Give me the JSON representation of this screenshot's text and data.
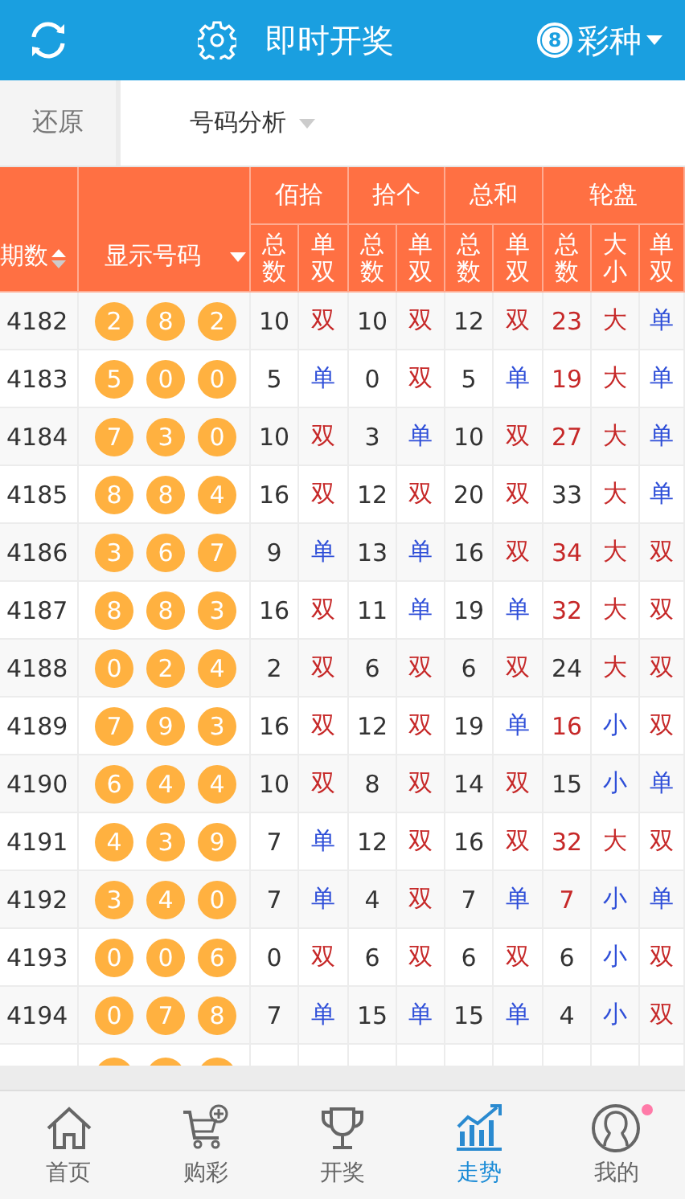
{
  "header": {
    "title": "即时开奖",
    "lottery_badge": "8",
    "lottery_label": "彩种"
  },
  "toolbar": {
    "reset": "还原",
    "filter": "号码分析"
  },
  "table": {
    "col_period": "期数",
    "col_numbers": "显示号码",
    "groups": [
      {
        "label": "佰拾",
        "sub": [
          "总数",
          "单双"
        ]
      },
      {
        "label": "拾个",
        "sub": [
          "总数",
          "单双"
        ]
      },
      {
        "label": "总和",
        "sub": [
          "总数",
          "单双"
        ]
      },
      {
        "label": "轮盘",
        "sub": [
          "总数",
          "大小",
          "单双"
        ]
      }
    ],
    "rows": [
      {
        "period": "4182",
        "balls": [
          "2",
          "8",
          "2"
        ],
        "cells": [
          {
            "text": "10",
            "color": "#333333"
          },
          {
            "text": "双",
            "color": "#c62828"
          },
          {
            "text": "10",
            "color": "#333333"
          },
          {
            "text": "双",
            "color": "#c62828"
          },
          {
            "text": "12",
            "color": "#333333"
          },
          {
            "text": "双",
            "color": "#c62828"
          },
          {
            "text": "23",
            "color": "#c62828"
          },
          {
            "text": "大",
            "color": "#c62828"
          },
          {
            "text": "单",
            "color": "#2f4fd8"
          }
        ]
      },
      {
        "period": "4183",
        "balls": [
          "5",
          "0",
          "0"
        ],
        "cells": [
          {
            "text": "5",
            "color": "#333333"
          },
          {
            "text": "单",
            "color": "#2f4fd8"
          },
          {
            "text": "0",
            "color": "#333333"
          },
          {
            "text": "双",
            "color": "#c62828"
          },
          {
            "text": "5",
            "color": "#333333"
          },
          {
            "text": "单",
            "color": "#2f4fd8"
          },
          {
            "text": "19",
            "color": "#c62828"
          },
          {
            "text": "大",
            "color": "#c62828"
          },
          {
            "text": "单",
            "color": "#2f4fd8"
          }
        ]
      },
      {
        "period": "4184",
        "balls": [
          "7",
          "3",
          "0"
        ],
        "cells": [
          {
            "text": "10",
            "color": "#333333"
          },
          {
            "text": "双",
            "color": "#c62828"
          },
          {
            "text": "3",
            "color": "#333333"
          },
          {
            "text": "单",
            "color": "#2f4fd8"
          },
          {
            "text": "10",
            "color": "#333333"
          },
          {
            "text": "双",
            "color": "#c62828"
          },
          {
            "text": "27",
            "color": "#c62828"
          },
          {
            "text": "大",
            "color": "#c62828"
          },
          {
            "text": "单",
            "color": "#2f4fd8"
          }
        ]
      },
      {
        "period": "4185",
        "balls": [
          "8",
          "8",
          "4"
        ],
        "cells": [
          {
            "text": "16",
            "color": "#333333"
          },
          {
            "text": "双",
            "color": "#c62828"
          },
          {
            "text": "12",
            "color": "#333333"
          },
          {
            "text": "双",
            "color": "#c62828"
          },
          {
            "text": "20",
            "color": "#333333"
          },
          {
            "text": "双",
            "color": "#c62828"
          },
          {
            "text": "33",
            "color": "#333333"
          },
          {
            "text": "大",
            "color": "#c62828"
          },
          {
            "text": "单",
            "color": "#2f4fd8"
          }
        ]
      },
      {
        "period": "4186",
        "balls": [
          "3",
          "6",
          "7"
        ],
        "cells": [
          {
            "text": "9",
            "color": "#333333"
          },
          {
            "text": "单",
            "color": "#2f4fd8"
          },
          {
            "text": "13",
            "color": "#333333"
          },
          {
            "text": "单",
            "color": "#2f4fd8"
          },
          {
            "text": "16",
            "color": "#333333"
          },
          {
            "text": "双",
            "color": "#c62828"
          },
          {
            "text": "34",
            "color": "#c62828"
          },
          {
            "text": "大",
            "color": "#c62828"
          },
          {
            "text": "双",
            "color": "#c62828"
          }
        ]
      },
      {
        "period": "4187",
        "balls": [
          "8",
          "8",
          "3"
        ],
        "cells": [
          {
            "text": "16",
            "color": "#333333"
          },
          {
            "text": "双",
            "color": "#c62828"
          },
          {
            "text": "11",
            "color": "#333333"
          },
          {
            "text": "单",
            "color": "#2f4fd8"
          },
          {
            "text": "19",
            "color": "#333333"
          },
          {
            "text": "单",
            "color": "#2f4fd8"
          },
          {
            "text": "32",
            "color": "#c62828"
          },
          {
            "text": "大",
            "color": "#c62828"
          },
          {
            "text": "双",
            "color": "#c62828"
          }
        ]
      },
      {
        "period": "4188",
        "balls": [
          "0",
          "2",
          "4"
        ],
        "cells": [
          {
            "text": "2",
            "color": "#333333"
          },
          {
            "text": "双",
            "color": "#c62828"
          },
          {
            "text": "6",
            "color": "#333333"
          },
          {
            "text": "双",
            "color": "#c62828"
          },
          {
            "text": "6",
            "color": "#333333"
          },
          {
            "text": "双",
            "color": "#c62828"
          },
          {
            "text": "24",
            "color": "#333333"
          },
          {
            "text": "大",
            "color": "#c62828"
          },
          {
            "text": "双",
            "color": "#c62828"
          }
        ]
      },
      {
        "period": "4189",
        "balls": [
          "7",
          "9",
          "3"
        ],
        "cells": [
          {
            "text": "16",
            "color": "#333333"
          },
          {
            "text": "双",
            "color": "#c62828"
          },
          {
            "text": "12",
            "color": "#333333"
          },
          {
            "text": "双",
            "color": "#c62828"
          },
          {
            "text": "19",
            "color": "#333333"
          },
          {
            "text": "单",
            "color": "#2f4fd8"
          },
          {
            "text": "16",
            "color": "#c62828"
          },
          {
            "text": "小",
            "color": "#2f4fd8"
          },
          {
            "text": "双",
            "color": "#c62828"
          }
        ]
      },
      {
        "period": "4190",
        "balls": [
          "6",
          "4",
          "4"
        ],
        "cells": [
          {
            "text": "10",
            "color": "#333333"
          },
          {
            "text": "双",
            "color": "#c62828"
          },
          {
            "text": "8",
            "color": "#333333"
          },
          {
            "text": "双",
            "color": "#c62828"
          },
          {
            "text": "14",
            "color": "#333333"
          },
          {
            "text": "双",
            "color": "#c62828"
          },
          {
            "text": "15",
            "color": "#333333"
          },
          {
            "text": "小",
            "color": "#2f4fd8"
          },
          {
            "text": "单",
            "color": "#2f4fd8"
          }
        ]
      },
      {
        "period": "4191",
        "balls": [
          "4",
          "3",
          "9"
        ],
        "cells": [
          {
            "text": "7",
            "color": "#333333"
          },
          {
            "text": "单",
            "color": "#2f4fd8"
          },
          {
            "text": "12",
            "color": "#333333"
          },
          {
            "text": "双",
            "color": "#c62828"
          },
          {
            "text": "16",
            "color": "#333333"
          },
          {
            "text": "双",
            "color": "#c62828"
          },
          {
            "text": "32",
            "color": "#c62828"
          },
          {
            "text": "大",
            "color": "#c62828"
          },
          {
            "text": "双",
            "color": "#c62828"
          }
        ]
      },
      {
        "period": "4192",
        "balls": [
          "3",
          "4",
          "0"
        ],
        "cells": [
          {
            "text": "7",
            "color": "#333333"
          },
          {
            "text": "单",
            "color": "#2f4fd8"
          },
          {
            "text": "4",
            "color": "#333333"
          },
          {
            "text": "双",
            "color": "#c62828"
          },
          {
            "text": "7",
            "color": "#333333"
          },
          {
            "text": "单",
            "color": "#2f4fd8"
          },
          {
            "text": "7",
            "color": "#c62828"
          },
          {
            "text": "小",
            "color": "#2f4fd8"
          },
          {
            "text": "单",
            "color": "#2f4fd8"
          }
        ]
      },
      {
        "period": "4193",
        "balls": [
          "0",
          "0",
          "6"
        ],
        "cells": [
          {
            "text": "0",
            "color": "#333333"
          },
          {
            "text": "双",
            "color": "#c62828"
          },
          {
            "text": "6",
            "color": "#333333"
          },
          {
            "text": "双",
            "color": "#c62828"
          },
          {
            "text": "6",
            "color": "#333333"
          },
          {
            "text": "双",
            "color": "#c62828"
          },
          {
            "text": "6",
            "color": "#333333"
          },
          {
            "text": "小",
            "color": "#2f4fd8"
          },
          {
            "text": "双",
            "color": "#c62828"
          }
        ]
      },
      {
        "period": "4194",
        "balls": [
          "0",
          "7",
          "8"
        ],
        "cells": [
          {
            "text": "7",
            "color": "#333333"
          },
          {
            "text": "单",
            "color": "#2f4fd8"
          },
          {
            "text": "15",
            "color": "#333333"
          },
          {
            "text": "单",
            "color": "#2f4fd8"
          },
          {
            "text": "15",
            "color": "#333333"
          },
          {
            "text": "单",
            "color": "#2f4fd8"
          },
          {
            "text": "4",
            "color": "#333333"
          },
          {
            "text": "小",
            "color": "#2f4fd8"
          },
          {
            "text": "双",
            "color": "#c62828"
          }
        ]
      }
    ]
  },
  "tabs": [
    {
      "label": "首页",
      "kind": "home",
      "selected": false,
      "dot": false
    },
    {
      "label": "购彩",
      "kind": "cart",
      "selected": false,
      "dot": false
    },
    {
      "label": "开奖",
      "kind": "trophy",
      "selected": false,
      "dot": false
    },
    {
      "label": "走势",
      "kind": "chart",
      "selected": true,
      "dot": false
    },
    {
      "label": "我的",
      "kind": "user",
      "selected": false,
      "dot": true
    }
  ]
}
